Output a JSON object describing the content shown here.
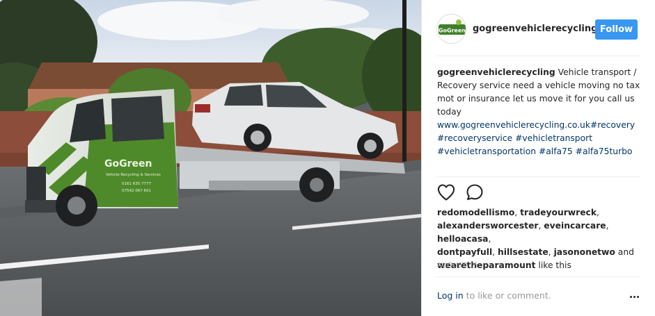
{
  "colors": {
    "follow_bg": "#3897f0",
    "link": "#003569",
    "muted": "#999999",
    "text": "#262626",
    "truck_green": "#4f8a2a"
  },
  "photo": {
    "truck_brand": "GoGreen",
    "truck_subtitle": "Vehicle Recycling & Services",
    "truck_phone1": "0161 635 7777",
    "truck_phone2": "07542 067 601"
  },
  "header": {
    "avatar_text": "GoGreen",
    "username": "gogreenvehiclerecycling",
    "follow_label": "Follow"
  },
  "caption": {
    "user": "gogreenvehiclerecycling",
    "text": " Vehicle transport / Recovery service need a vehicle moving no tax mot or insurance let us move it for you call us today ",
    "website": "www.gogreenvehiclerecycling.co.uk",
    "hashtags": [
      "#recovery",
      "#recoveryservice",
      "#vehicletransport",
      "#vehicletransportation",
      "#alfa75",
      "#alfa75turbo"
    ]
  },
  "actions": {
    "like_icon": "heart-outline-icon",
    "comment_icon": "comment-bubble-icon"
  },
  "likes": {
    "users": [
      "redomodellismo",
      "tradeyourwreck",
      "alexandersworcester",
      "eveincarcare",
      "helloacasa",
      "dontpayfull",
      "hillsestate",
      "jasononetwo",
      "weare theparamount"
    ],
    "and_word": "and",
    "suffix": "like this"
  },
  "date": "AUGUST 15",
  "footer": {
    "login_label": "Log in",
    "login_suffix": " to like or comment.",
    "more_icon": "more-options-icon"
  }
}
